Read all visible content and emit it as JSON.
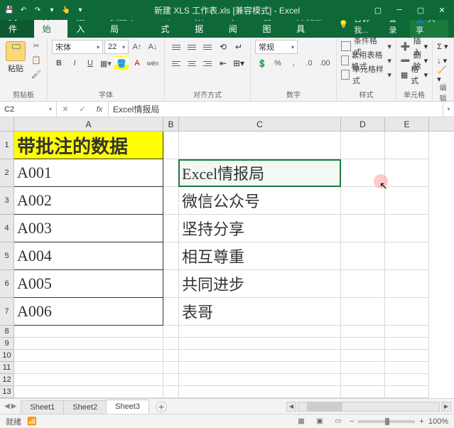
{
  "title": "新建 XLS 工作表.xls  [兼容模式] - Excel",
  "tabs": {
    "file": "文件",
    "start": "开始",
    "insert": "插入",
    "layout": "页面布局",
    "formula": "公式",
    "data": "数据",
    "review": "审阅",
    "view": "视图",
    "dev": "开发工具",
    "tell": "告诉我...",
    "login": "登录",
    "share": "共享"
  },
  "ribbon": {
    "clipboard": {
      "label": "剪贴板",
      "paste": "粘贴"
    },
    "font": {
      "label": "字体",
      "name": "宋体",
      "size": "22"
    },
    "align": {
      "label": "对齐方式"
    },
    "number": {
      "label": "数字",
      "format": "常规"
    },
    "styles": {
      "label": "样式",
      "cond": "条件格式",
      "table": "套用表格格式",
      "cell": "单元格样式"
    },
    "cells": {
      "label": "单元格",
      "insert": "插入",
      "delete": "删除",
      "format": "格式"
    },
    "editing": {
      "label": "编辑"
    }
  },
  "namebox": "C2",
  "formula": "Excel情报局",
  "cols": [
    "A",
    "B",
    "C",
    "D",
    "E"
  ],
  "rows": [
    {
      "n": "1",
      "A": "带批注的数据",
      "hdr": true
    },
    {
      "n": "2",
      "A": "A001",
      "C": "Excel情报局",
      "cm": true
    },
    {
      "n": "3",
      "A": "A002",
      "C": "微信公众号",
      "cm": true
    },
    {
      "n": "4",
      "A": "A003",
      "C": "坚持分享",
      "cm": true
    },
    {
      "n": "5",
      "A": "A004",
      "C": "相互尊重",
      "cm": true
    },
    {
      "n": "6",
      "A": "A005",
      "C": "共同进步",
      "cm": true
    },
    {
      "n": "7",
      "A": "A006",
      "C": "表哥",
      "cm": true
    }
  ],
  "smallrows": [
    "8",
    "9",
    "10",
    "11",
    "12",
    "13"
  ],
  "sheets": {
    "s1": "Sheet1",
    "s2": "Sheet2",
    "s3": "Sheet3"
  },
  "status": {
    "ready": "就绪",
    "calc": "📶",
    "zoom": "100%"
  }
}
